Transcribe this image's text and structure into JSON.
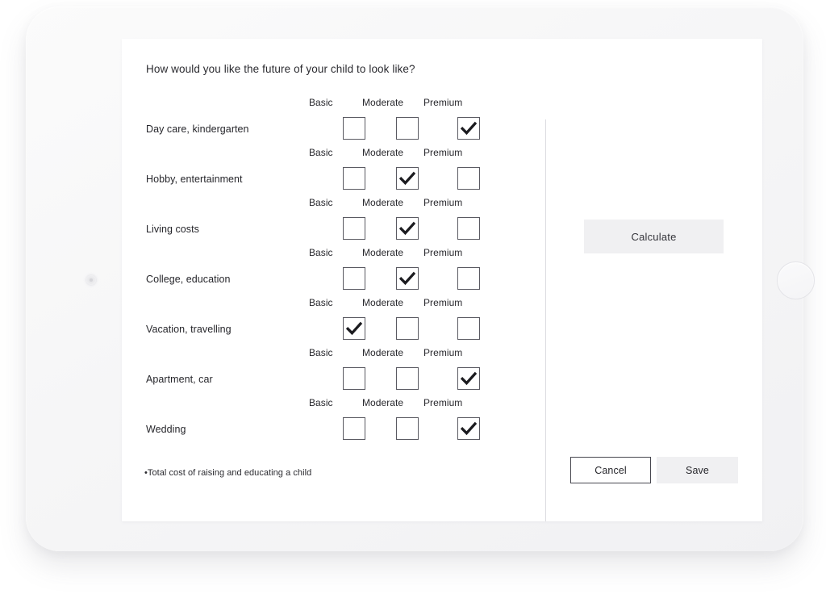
{
  "device": {
    "type": "tablet",
    "camera_icon": "camera-dot-icon",
    "home_button_icon": "home-button-icon"
  },
  "form": {
    "title": "How would you like the future of your child to look like?",
    "footnote": "•Total cost of raising and educating a child",
    "tier_labels": [
      "Basic",
      "Moderate",
      "Premium"
    ],
    "rows": [
      {
        "label": "Day care, kindergarten",
        "selected": "Premium"
      },
      {
        "label": "Hobby, entertainment",
        "selected": "Moderate"
      },
      {
        "label": "Living costs",
        "selected": "Moderate"
      },
      {
        "label": "College, education",
        "selected": "Moderate"
      },
      {
        "label": "Vacation, travelling",
        "selected": "Basic"
      },
      {
        "label": "Apartment, car",
        "selected": "Premium"
      },
      {
        "label": "Wedding",
        "selected": "Premium"
      }
    ]
  },
  "actions": {
    "calculate_label": "Calculate",
    "cancel_label": "Cancel",
    "save_label": "Save"
  },
  "colors": {
    "button_fill": "#f0f0f2",
    "checkbox_border": "#5a5a62",
    "check_mark": "#1b1b1f",
    "divider": "#dcdce0",
    "text": "#26262b",
    "device_body": "#f6f6f7"
  }
}
